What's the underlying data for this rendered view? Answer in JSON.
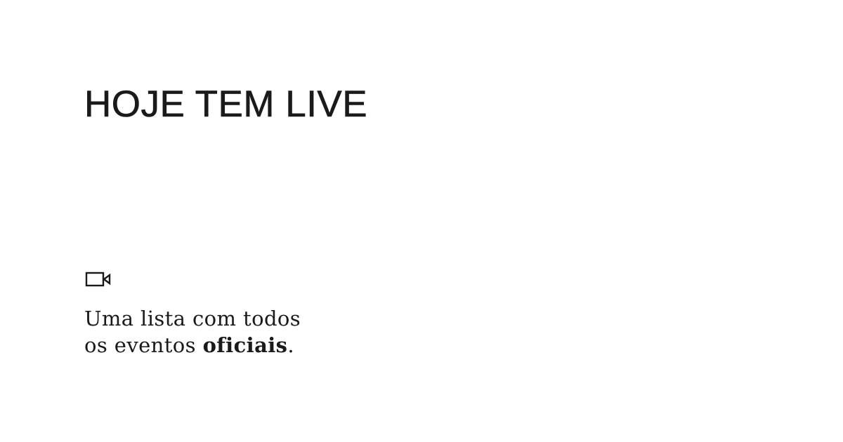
{
  "header": {
    "title": "HOJE TEM LIVE"
  },
  "feature": {
    "icon": "video-camera-icon",
    "tagline_line1": "Uma lista com todos",
    "tagline_line2_prefix": "os eventos ",
    "tagline_line2_bold": "oficiais",
    "tagline_line2_suffix": "."
  },
  "colors": {
    "background": "#ffffff",
    "text": "#1a1a1a"
  }
}
